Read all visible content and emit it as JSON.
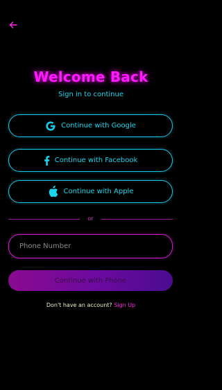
{
  "header": {
    "back_icon": "arrow-left-icon"
  },
  "title": "Welcome Back",
  "subtitle": "Sign in to continue",
  "social_buttons": [
    {
      "icon": "google-icon",
      "label": "Continue with Google"
    },
    {
      "icon": "facebook-icon",
      "label": "Continue with Facebook"
    },
    {
      "icon": "apple-icon",
      "label": "Continue with Apple"
    }
  ],
  "divider": {
    "label": "or"
  },
  "phone": {
    "placeholder": "Phone Number",
    "value": ""
  },
  "primary_button": {
    "label": "Continue with Phone"
  },
  "footer": {
    "prompt": "Don't have an account?",
    "link": "Sign Up"
  },
  "colors": {
    "background": "#000000",
    "accent_magenta": "#ff1aff",
    "accent_cyan": "#19d6ee",
    "primary_gradient_start": "#8a0a8f",
    "primary_gradient_end": "#4a0c8e"
  }
}
